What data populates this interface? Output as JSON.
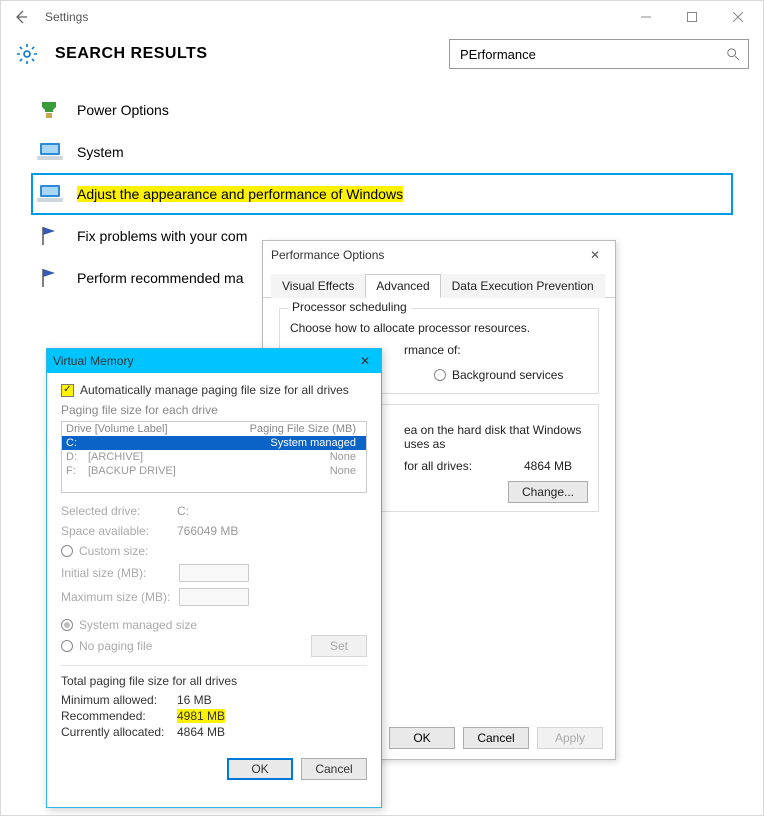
{
  "titlebar": {
    "title": "Settings"
  },
  "header": {
    "title": "SEARCH RESULTS"
  },
  "search": {
    "value": "PErformance"
  },
  "results": [
    {
      "label": "Power Options"
    },
    {
      "label": "System"
    },
    {
      "label": "Adjust the appearance and performance of Windows"
    },
    {
      "label": "Fix problems with your com"
    },
    {
      "label": "Perform recommended ma"
    }
  ],
  "perf": {
    "title": "Performance Options",
    "tabs": {
      "visual": "Visual Effects",
      "advanced": "Advanced",
      "dep": "Data Execution Prevention"
    },
    "sched": {
      "legend": "Processor scheduling",
      "desc": "Choose how to allocate processor resources.",
      "adjust": "rmance of:",
      "bg": "Background services"
    },
    "vm": {
      "desc": "ea on the hard disk that Windows uses as",
      "total_label": "for all drives:",
      "total_value": "4864 MB",
      "change": "Change..."
    },
    "btn_ok": "OK",
    "btn_cancel": "Cancel",
    "btn_apply": "Apply"
  },
  "vm": {
    "title": "Virtual Memory",
    "auto": "Automatically manage paging file size for all drives",
    "paging_each": "Paging file size for each drive",
    "hdr_drive": "Drive  [Volume Label]",
    "hdr_size": "Paging File Size (MB)",
    "drives": [
      {
        "letter": "C:",
        "label": "",
        "size": "System managed"
      },
      {
        "letter": "D:",
        "label": "[ARCHIVE]",
        "size": "None"
      },
      {
        "letter": "F:",
        "label": "[BACKUP DRIVE]",
        "size": "None"
      }
    ],
    "selected_drive_label": "Selected drive:",
    "selected_drive_value": "C:",
    "space_label": "Space available:",
    "space_value": "766049 MB",
    "custom": "Custom size:",
    "initial": "Initial size (MB):",
    "maximum": "Maximum size (MB):",
    "sys_managed": "System managed size",
    "no_paging": "No paging file",
    "set": "Set",
    "total_title": "Total paging file size for all drives",
    "min_label": "Minimum allowed:",
    "min_value": "16 MB",
    "rec_label": "Recommended:",
    "rec_value": "4981 MB",
    "cur_label": "Currently allocated:",
    "cur_value": "4864 MB",
    "ok": "OK",
    "cancel": "Cancel"
  }
}
